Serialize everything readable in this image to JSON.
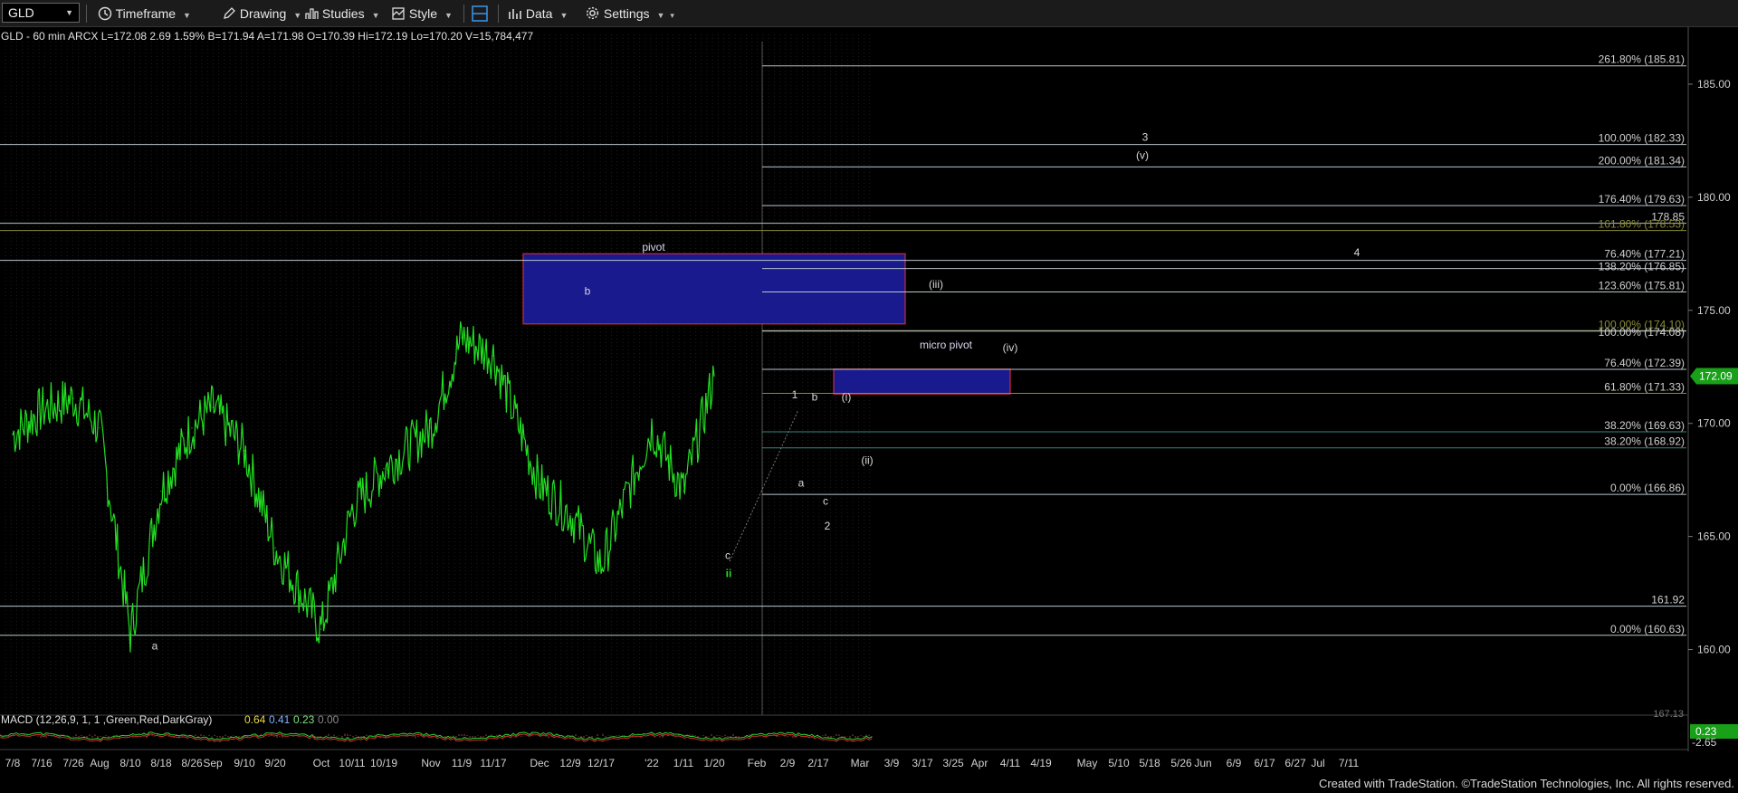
{
  "toolbar": {
    "symbol": "GLD",
    "timeframe": "Timeframe",
    "drawing": "Drawing",
    "studies": "Studies",
    "style": "Style",
    "data": "Data",
    "settings": "Settings"
  },
  "header_text": "GLD - 60 min  ARCX  L=172.08  2.69  1.59%  B=171.94  A=171.98  O=170.39  Hi=172.19  Lo=170.20  V=15,784,477",
  "footer": "Created with TradeStation. ©TradeStation Technologies, Inc. All rights reserved.",
  "colors": {
    "background": "#000000",
    "price_line": "#22dd22",
    "pivot_box": "#1a1a8f",
    "pivot_border": "#d0283c",
    "level_line": "#b8c4cc",
    "olive_line": "#8b8b38",
    "teal_line": "#2f8a7a",
    "last_price_tag": "#19a019"
  },
  "chart_data": {
    "type": "line",
    "title": "GLD - 60 min",
    "ylim": [
      157.1,
      187.2
    ],
    "y_ticks": [
      "185.00",
      "180.00",
      "175.00",
      "170.00",
      "165.00",
      "160.00"
    ],
    "x_tick_labels": [
      "7/8",
      "7/16",
      "7/26",
      "Aug",
      "8/10",
      "8/18",
      "8/26",
      "Sep",
      "9/10",
      "9/20",
      "Oct",
      "10/11",
      "10/19",
      "Nov",
      "11/9",
      "11/17",
      "Dec",
      "12/9",
      "12/17",
      "'22",
      "1/11",
      "1/20",
      "Feb",
      "2/9",
      "2/17",
      "Mar",
      "3/9",
      "3/17",
      "3/25",
      "Apr",
      "4/11",
      "4/19",
      "May",
      "5/10",
      "5/18",
      "5/26",
      "Jun",
      "6/9",
      "6/17",
      "6/27",
      "Jul",
      "7/11"
    ],
    "last_price_tag": "172.09",
    "series": [
      {
        "name": "GLD",
        "x": [
          "7/8",
          "7/16",
          "7/26",
          "Aug",
          "8/10",
          "8/18",
          "8/26",
          "Sep",
          "9/10",
          "9/20",
          "Oct",
          "10/11",
          "10/19",
          "Nov",
          "11/9",
          "11/17",
          "Dec",
          "12/9",
          "12/17",
          "'22",
          "1/11",
          "1/20"
        ],
        "values": [
          169.5,
          170.6,
          171.1,
          169.8,
          160.7,
          167.0,
          169.8,
          170.7,
          168.8,
          164.5,
          160.9,
          166.2,
          168.0,
          169.8,
          173.8,
          173.0,
          167.3,
          166.0,
          163.7,
          169.8,
          167.0,
          172.09
        ]
      }
    ],
    "levels": [
      {
        "label": "261.80% (185.81)",
        "y": 185.81
      },
      {
        "label": "100.00% (182.33)",
        "y": 182.33
      },
      {
        "label": "200.00% (181.34)",
        "y": 181.34
      },
      {
        "label": "176.40% (179.63)",
        "y": 179.63
      },
      {
        "label": "178.85",
        "y": 178.85
      },
      {
        "label": "161.80% (178.53)",
        "y": 178.53
      },
      {
        "label": "76.40% (177.21)",
        "y": 177.21
      },
      {
        "label": "138.20% (176.85)",
        "y": 176.85
      },
      {
        "label": "123.60% (175.81)",
        "y": 175.81
      },
      {
        "label": "100.00% (174.10)",
        "y": 174.1
      },
      {
        "label": "100.00% (174.08)",
        "y": 174.08
      },
      {
        "label": "76.40% (172.39)",
        "y": 172.39
      },
      {
        "label": "61.80% (171.33)",
        "y": 171.33
      },
      {
        "label": "38.20% (169.63)",
        "y": 169.63
      },
      {
        "label": "38.20% (168.92)",
        "y": 168.92
      },
      {
        "label": "0.00% (166.86)",
        "y": 166.86
      },
      {
        "label": "161.92",
        "y": 161.92
      },
      {
        "label": "0.00% (160.63)",
        "y": 160.63
      }
    ],
    "boxes": [
      {
        "label": "pivot",
        "x": [
          "11/1",
          "1/27"
        ],
        "y": [
          174.4,
          177.5
        ]
      },
      {
        "label": "micro pivot",
        "x": [
          "1/13",
          "2/7"
        ],
        "y": [
          171.3,
          172.4
        ]
      }
    ],
    "wave_labels": [
      "a",
      "b",
      "c",
      "ii",
      "1",
      "a",
      "b",
      "c",
      "2",
      "(i)",
      "(ii)",
      "(iii)",
      "(iv)",
      "(v)",
      "3",
      "4"
    ],
    "macd": {
      "label": "MACD (12,26,9, 1, 1 ,Green,Red,DarkGray)",
      "values": [
        "0.64",
        "0.41",
        "0.23",
        "0.00"
      ],
      "tags": [
        "0.23",
        "-2.65"
      ],
      "upper_tick": "167.13"
    }
  }
}
